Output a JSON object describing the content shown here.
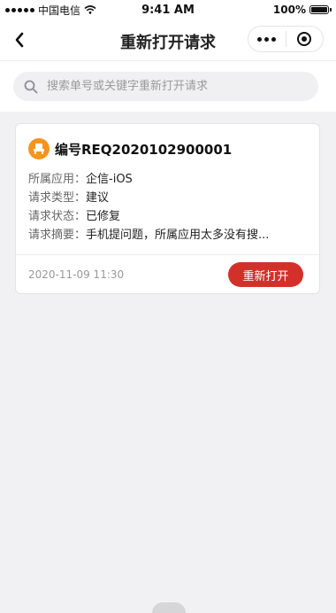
{
  "status_bar": {
    "carrier": "中国电信",
    "time": "9:41 AM",
    "battery": "100%",
    "battery_level": 1.0
  },
  "nav": {
    "title": "重新打开请求",
    "back_icon": "chevron-left-icon",
    "more_icon": "more-dots-icon",
    "close_icon": "target-close-icon"
  },
  "search": {
    "placeholder": "搜索单号或关键字重新打开请求",
    "value": "",
    "icon": "search-icon"
  },
  "requests": [
    {
      "title": "编号REQ2020102900001",
      "avatar_icon": "user-seat-icon",
      "avatar_color": "#f7941d",
      "fields": [
        {
          "label": "所属应用：",
          "value": "企信-iOS"
        },
        {
          "label": "请求类型：",
          "value": "建议"
        },
        {
          "label": "请求状态：",
          "value": "已修复"
        },
        {
          "label": "请求摘要：",
          "value": "手机提问题，所属应用太多没有搜..."
        }
      ],
      "timestamp": "2020-11-09  11:30",
      "action_label": "重新打开",
      "action_color": "#d4302a"
    }
  ]
}
